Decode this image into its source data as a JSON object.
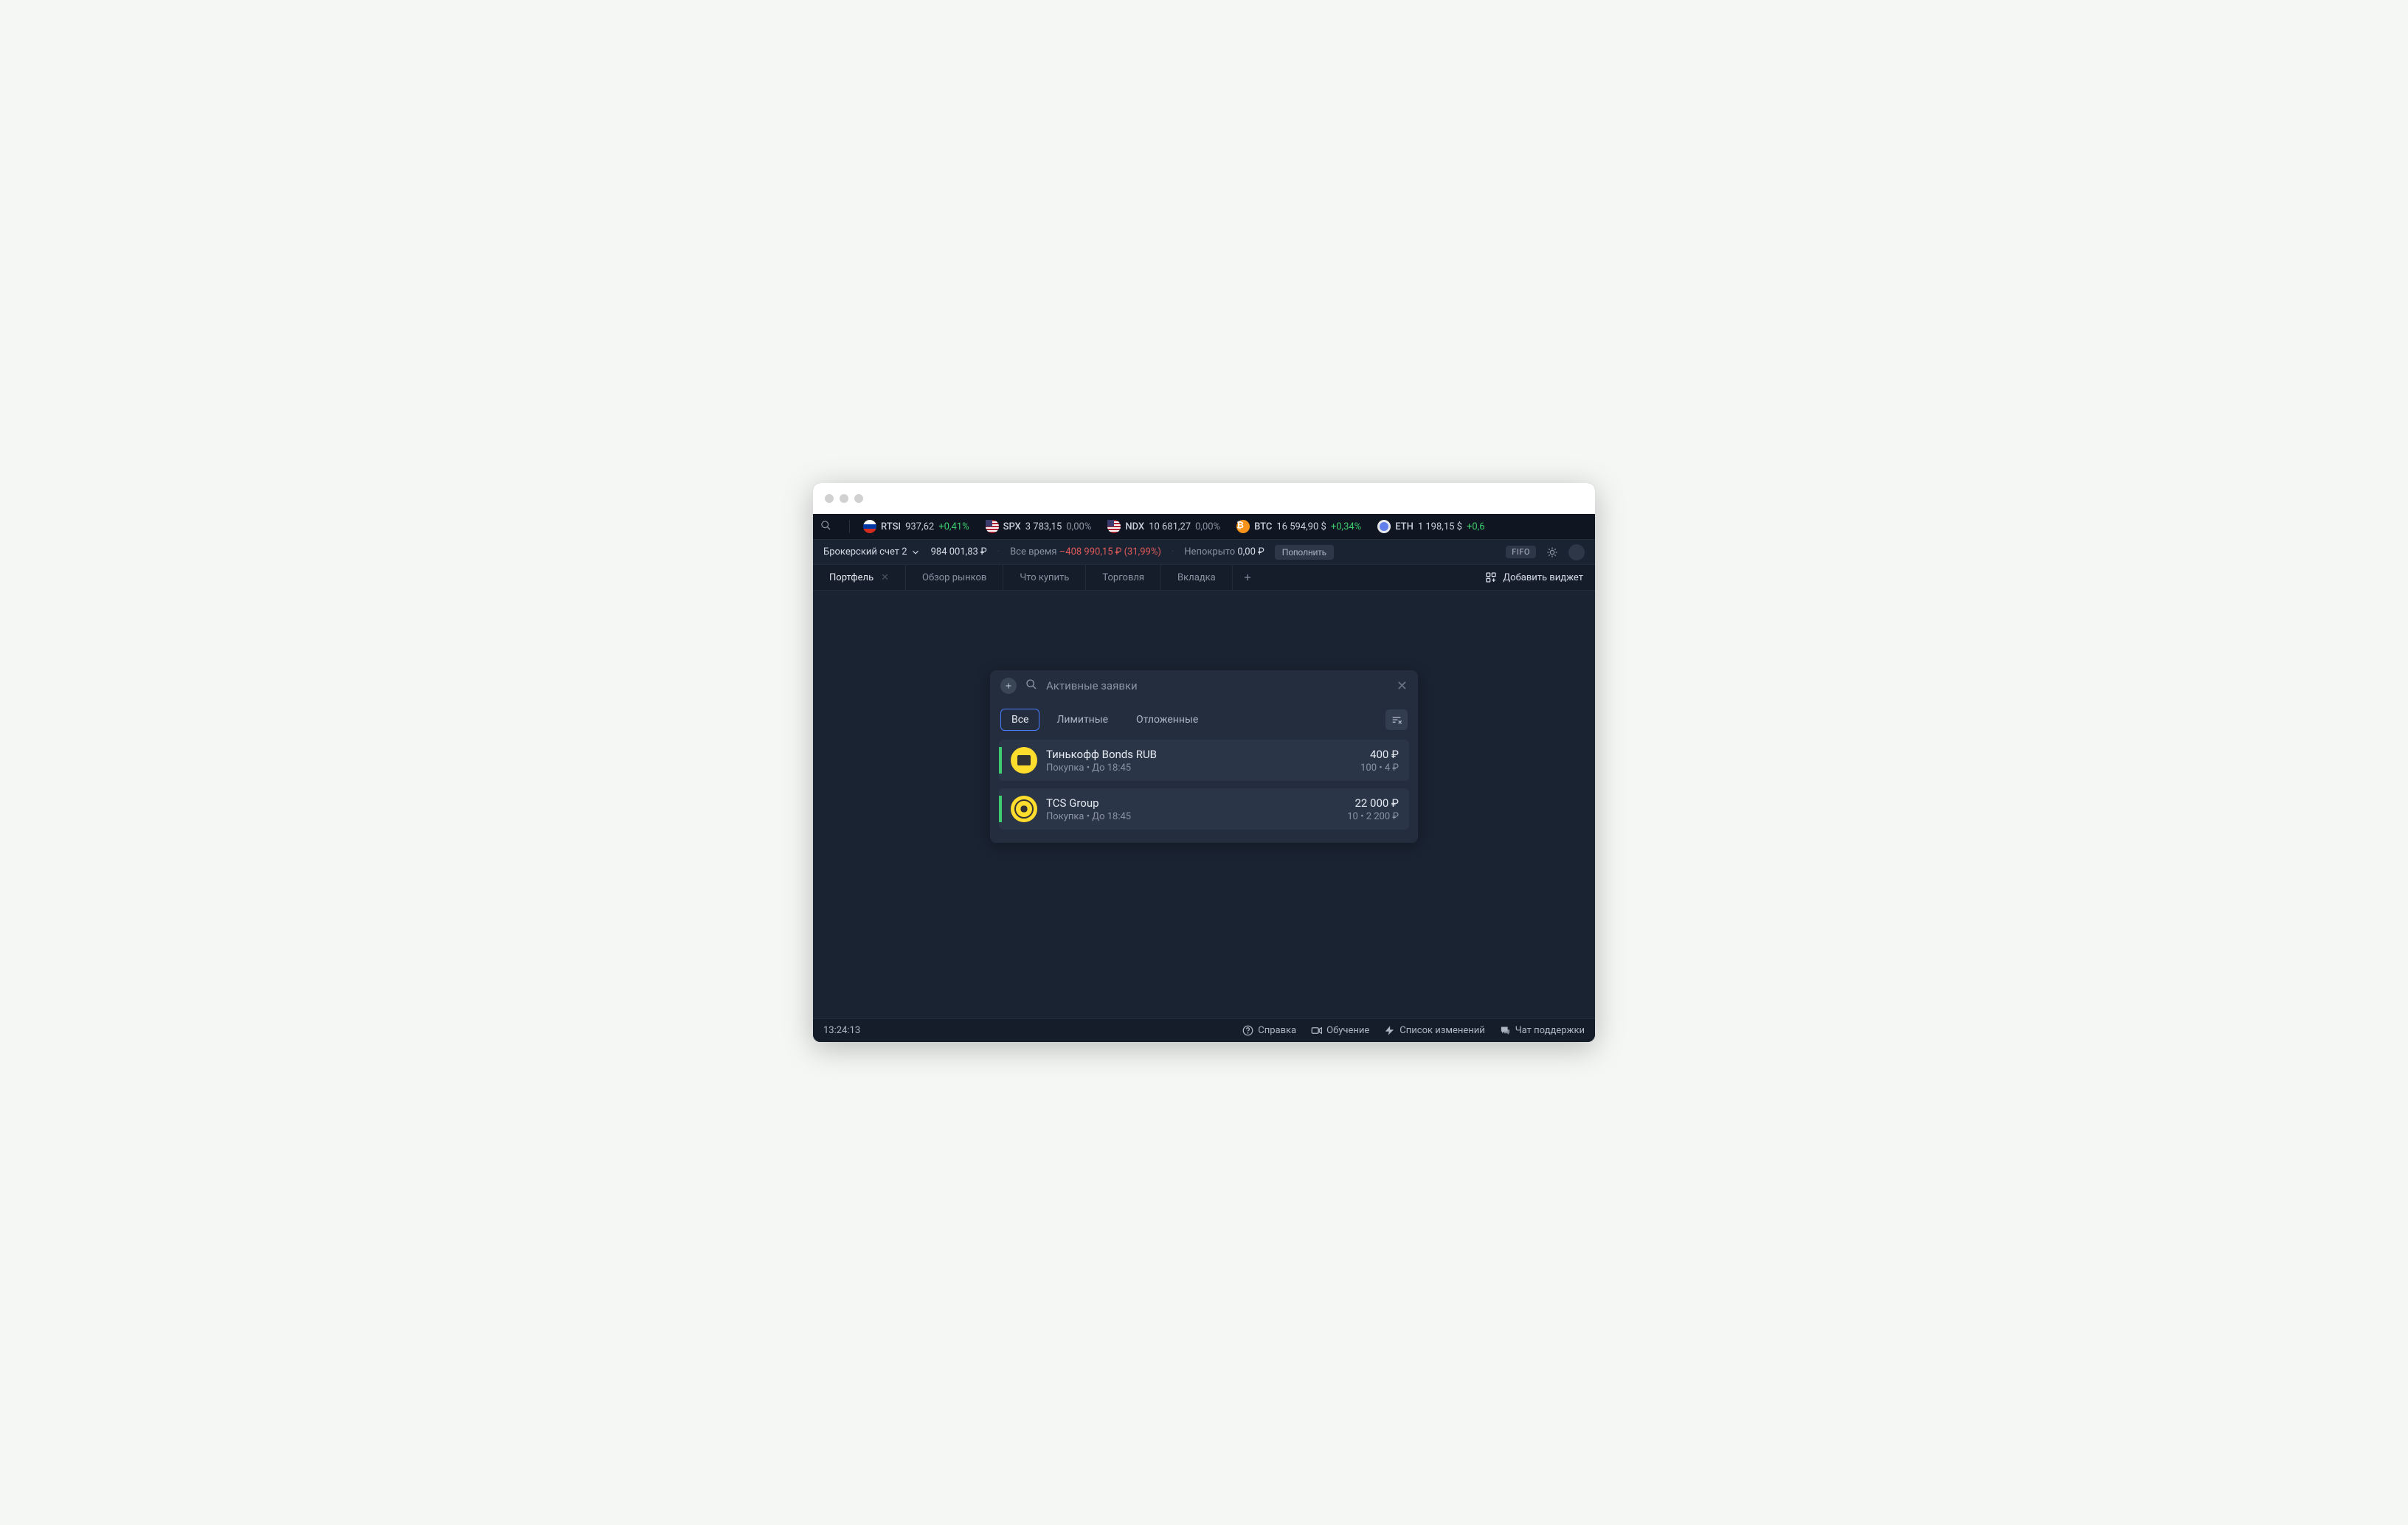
{
  "tickers": [
    {
      "symbol": "RTSI",
      "value": "937,62",
      "change": "+0,41%",
      "pos": true,
      "flag": "ru"
    },
    {
      "symbol": "SPX",
      "value": "3 783,15",
      "change": "0,00%",
      "pos": false,
      "flag": "us"
    },
    {
      "symbol": "NDX",
      "value": "10 681,27",
      "change": "0,00%",
      "pos": false,
      "flag": "us"
    },
    {
      "symbol": "BTC",
      "value": "16 594,90 $",
      "change": "+0,34%",
      "pos": true,
      "flag": "btc"
    },
    {
      "symbol": "ETH",
      "value": "1 198,15 $",
      "change": "+0,6",
      "pos": true,
      "flag": "eth"
    }
  ],
  "account": {
    "name": "Брокерский счет 2",
    "balance": "984 001,83 ₽",
    "period_label": "Все время",
    "change": "–408 990,15 ₽ (31,99%)",
    "uncovered_label": "Непокрыто",
    "uncovered_value": "0,00 ₽",
    "topup_label": "Пополнить",
    "fifo": "FIFO"
  },
  "tabs": [
    {
      "label": "Портфель",
      "active": true,
      "closable": true
    },
    {
      "label": "Обзор рынков",
      "active": false,
      "closable": false
    },
    {
      "label": "Что купить",
      "active": false,
      "closable": false
    },
    {
      "label": "Торговля",
      "active": false,
      "closable": false
    },
    {
      "label": "Вкладка",
      "active": false,
      "closable": false
    }
  ],
  "add_widget_label": "Добавить виджет",
  "widget": {
    "title": "Активные заявки",
    "filters": [
      {
        "label": "Все",
        "active": true
      },
      {
        "label": "Лимитные",
        "active": false
      },
      {
        "label": "Отложенные",
        "active": false
      }
    ],
    "orders": [
      {
        "name": "Тинькофф Bonds RUB",
        "side": "Покупка",
        "until": "До 18:45",
        "amount": "400 ₽",
        "qty": "100",
        "price": "4 ₽",
        "logo": "bonds"
      },
      {
        "name": "TCS Group",
        "side": "Покупка",
        "until": "До 18:45",
        "amount": "22 000 ₽",
        "qty": "10",
        "price": "2 200 ₽",
        "logo": "tcs"
      }
    ]
  },
  "status": {
    "clock": "13:24:13",
    "help": "Справка",
    "training": "Обучение",
    "changelog": "Список изменений",
    "support": "Чат поддержки"
  }
}
